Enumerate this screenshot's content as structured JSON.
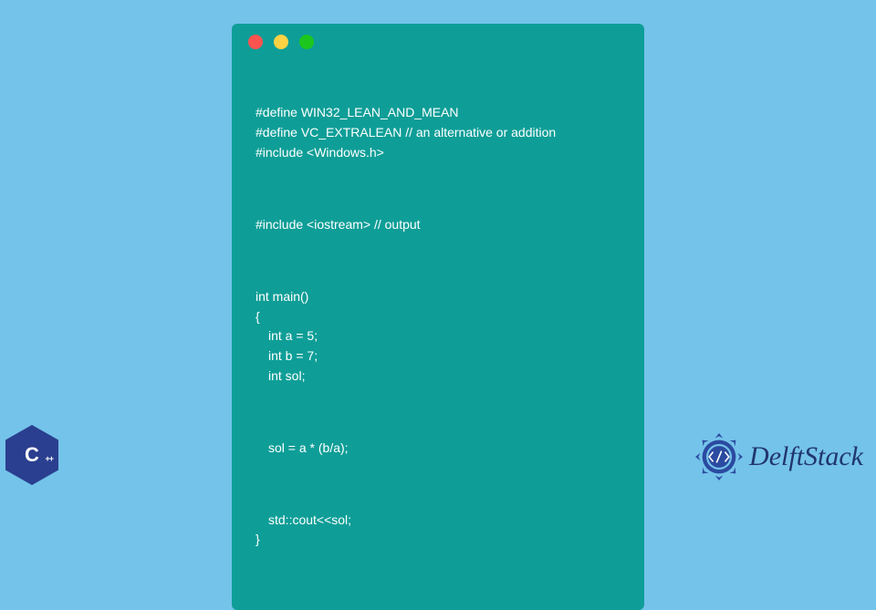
{
  "window": {
    "dots": {
      "red": "#ff5350",
      "yellow": "#ffd244",
      "green": "#1dc61d"
    },
    "bg": "#0e9e97"
  },
  "code": {
    "block1_line1": "#define WIN32_LEAN_AND_MEAN",
    "block1_line2": "#define VC_EXTRALEAN // an alternative or addition",
    "block1_line3": "#include <Windows.h>",
    "block2_line1": "#include <iostream> // output",
    "block3_line1": "int main()",
    "block3_line2": "{",
    "block3_line3": " int a = 5;",
    "block3_line4": " int b = 7;",
    "block3_line5": " int sol;",
    "block4_line1": " sol = a * (b/a);",
    "block5_line1": " std::cout<<sol;",
    "block5_line2": "}"
  },
  "badges": {
    "cpp_letter": "C",
    "cpp_plus": "++",
    "brand": "DelftStack"
  },
  "colors": {
    "page_bg": "#74c3ea",
    "brand_text": "#20356e"
  }
}
